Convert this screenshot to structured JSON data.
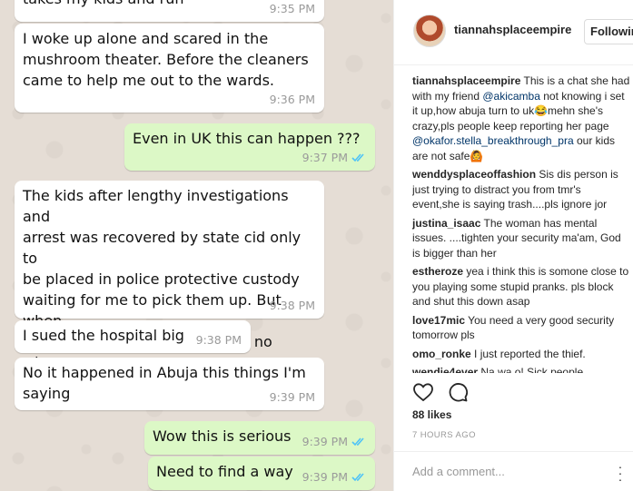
{
  "chat": {
    "messages": [
      {
        "dir": "in",
        "text": "takes my kids and run",
        "time": "9:35 PM"
      },
      {
        "dir": "in",
        "text": "I woke up alone and scared in the\nmushroom theater. Before the cleaners\ncame to help me out to the wards.",
        "time": "9:36 PM"
      },
      {
        "dir": "out",
        "text": "Even in UK this can happen ???",
        "time": "9:37 PM"
      },
      {
        "dir": "in",
        "text": "The kids after lengthy investigations and\narrest was recovered by state cid only to\nbe placed in police protective custody\nwaiting for me to pick them up. But when\nI send my uncle the kids where no where\nto be found",
        "time": "9:38 PM"
      },
      {
        "dir": "in",
        "text": "I sued the hospital big",
        "time": "9:38 PM"
      },
      {
        "dir": "in",
        "text": "No it happened in Abuja this things I'm\nsaying",
        "time": "9:39 PM"
      },
      {
        "dir": "out",
        "text": "Wow this is serious",
        "time": "9:39 PM"
      },
      {
        "dir": "out",
        "text": "Need to find a way",
        "time": "9:39 PM"
      }
    ]
  },
  "post": {
    "username": "tiannahsplaceempire",
    "follow_label": "Following",
    "caption": {
      "user": "tiannahsplaceempire",
      "parts": [
        {
          "t": "This is a chat she had with my friend "
        },
        {
          "t": "@akicamba",
          "mention": true
        },
        {
          "t": " not knowing i set it up,how abuja turn to uk😂mehn she's crazy,pls people keep reporting her page "
        },
        {
          "t": "@okafor.stella_breakthrough_pra",
          "mention": true
        },
        {
          "t": " our kids are not safe🙆"
        }
      ]
    },
    "comments": [
      {
        "user": "wenddysplaceoffashion",
        "text": "Sis dis person is just trying to distract you from tmr's event,she is saying trash....pls ignore jor"
      },
      {
        "user": "justina_isaac",
        "text": "The woman has mental issues. ....tighten your security ma'am, God is bigger than her"
      },
      {
        "user": "estheroze",
        "text": "yea i think this is somone close to you playing some stupid pranks. pls block and shut this down asap"
      },
      {
        "user": "love17mic",
        "text": "You need a very good security tomorrow pls"
      },
      {
        "user": "omo_ronke",
        "text": "I just reported the thief."
      },
      {
        "user": "wendie4ever",
        "text": "Na wa o! Sick people"
      }
    ],
    "likes": "88 likes",
    "time_ago": "7 HOURS AGO",
    "comment_placeholder": "Add a comment...",
    "more_icon": "more-dots-icon",
    "colors": {
      "mention": "#003569",
      "tick_blue": "#4fc3f7",
      "out_bubble": "#dcf8c6"
    }
  }
}
